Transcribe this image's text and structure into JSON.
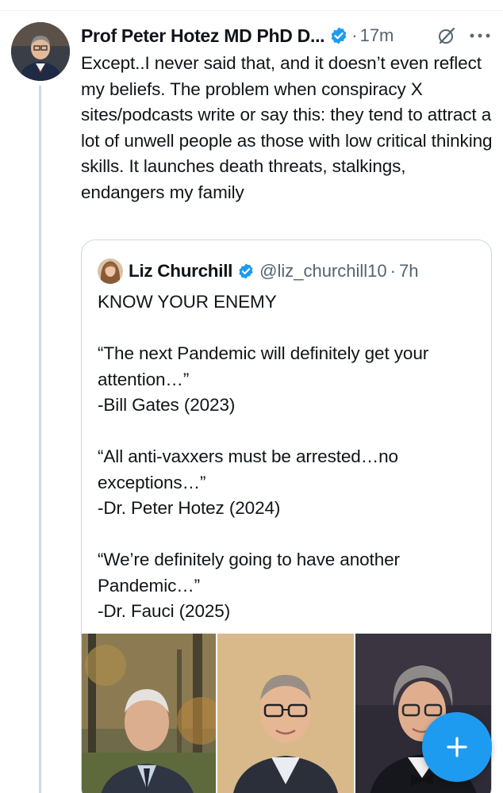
{
  "tweet": {
    "author_name": "Prof Peter Hotez MD PhD D...",
    "separator": "·",
    "time": "17m",
    "text": "Except..I never said that, and it doesn’t even reflect my beliefs. The problem when conspiracy X sites/podcasts write or say this: they tend to attract a lot of unwell people as those with low critical thinking skills. It launches death threats, stalkings, endangers my family",
    "icons": {
      "verified": "verified-badge-icon",
      "grok": "grok-icon",
      "more": "more-options-icon"
    }
  },
  "quote": {
    "author_name": "Liz Churchill",
    "handle": "@liz_churchill10",
    "separator": "·",
    "time": "7h",
    "text": "KNOW YOUR ENEMY\n\n“The next Pandemic will definitely get your attention…”\n-Bill Gates (2023)\n\n“All anti-vaxxers must be arrested…no exceptions…”\n-Dr. Peter Hotez (2024)\n\n“We’re definitely going to have another Pandemic…”\n-Dr. Fauci (2025)",
    "media": [
      "photo-man-suit-outdoors",
      "photo-man-glasses-sweater",
      "photo-man-bowtie"
    ]
  },
  "compose": {
    "icon": "plus-icon"
  },
  "colors": {
    "accent": "#1d9bf0",
    "text": "#0f1419",
    "muted": "#536471",
    "border": "#cfd9de"
  }
}
